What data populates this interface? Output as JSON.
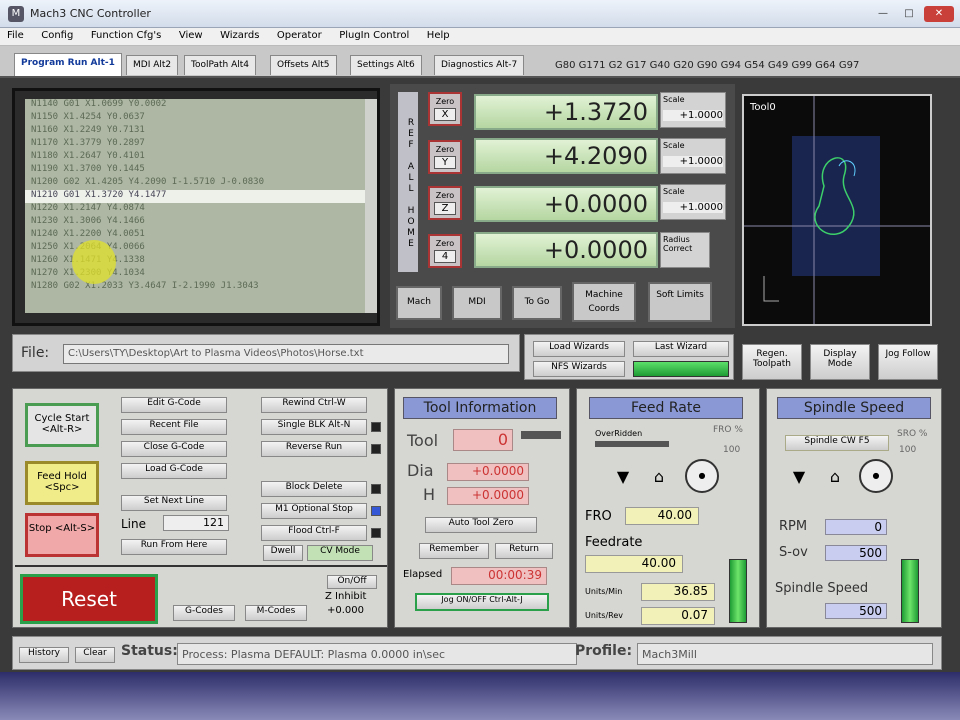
{
  "window": {
    "title": "Mach3 CNC Controller"
  },
  "menu": [
    "File",
    "Config",
    "Function Cfg's",
    "View",
    "Wizards",
    "Operator",
    "PlugIn Control",
    "Help"
  ],
  "tabs": [
    {
      "label": "Program Run Alt-1",
      "active": true
    },
    {
      "label": "MDI Alt2"
    },
    {
      "label": "ToolPath Alt4"
    },
    {
      "label": "Offsets Alt5"
    },
    {
      "label": "Settings Alt6"
    },
    {
      "label": "Diagnostics Alt-7"
    }
  ],
  "modal_codes": "G80 G171 G2 G17 G40 G20 G90 G94 G54 G49 G99 G64 G97",
  "gcode_lines": [
    "N1140 G01 X1.0699 Y0.0002",
    "N1150 X1.4254 Y0.0637",
    "N1160 X1.2249 Y0.7131",
    "N1170 X1.3779 Y0.2897",
    "N1180 X1.2647 Y0.4101",
    "N1190 X1.3700 Y0.1445",
    "N1200 G02 X1.4205 Y4.2090 I-1.5710 J-0.0830",
    "N1210 G01 X1.3720 Y4.1477",
    "N1220 X1.2147 Y4.0874",
    "N1230 X1.3006 Y4.1466",
    "N1240 X1.2200 Y4.0051",
    "N1250 X1.2064 Y4.0066",
    "N1260 X1.1471 Y4.1338",
    "N1270 X1.2300 Y4.1034",
    "N1280 G02 X1.2033 Y3.4647 I-2.1990 J1.3043"
  ],
  "dro": {
    "axes_letters": "REF ALL HOME",
    "rows": [
      {
        "ref": "Zero",
        "axis": "X",
        "value": "+1.3720",
        "scale_label": "Scale",
        "scale": "+1.0000"
      },
      {
        "ref": "Zero",
        "axis": "Y",
        "value": "+4.2090",
        "scale_label": "Scale",
        "scale": "+1.0000"
      },
      {
        "ref": "Zero",
        "axis": "Z",
        "value": "+0.0000",
        "scale_label": "Scale",
        "scale": "+1.0000"
      },
      {
        "ref": "Zero",
        "axis": "4",
        "value": "+0.0000",
        "scale_label": "Radius Correct",
        "scale": ""
      }
    ],
    "buttons": [
      "Mach",
      "MDI",
      "To Go",
      "Machine Coords",
      "Soft Limits"
    ]
  },
  "toolpath": {
    "label": "Tool0"
  },
  "file": {
    "label": "File:",
    "path": "C:\\Users\\TY\\Desktop\\Art to Plasma Videos\\Photos\\Horse.txt"
  },
  "wizards": {
    "load": "Load Wizards",
    "last": "Last Wizard",
    "nfs": "NFS Wizards"
  },
  "view_buttons": [
    "Regen. Toolpath",
    "Display Mode",
    "Jog Follow"
  ],
  "controls": {
    "cycle_start": "Cycle Start <Alt-R>",
    "feed_hold": "Feed Hold <Spc>",
    "stop": "Stop <Alt-S>",
    "edit": "Edit G-Code",
    "recent": "Recent File",
    "close": "Close G-Code",
    "load": "Load G-Code",
    "set_next": "Set Next Line",
    "line_label": "Line",
    "line_value": "121",
    "run_from": "Run From Here",
    "rewind": "Rewind Ctrl-W",
    "single": "Single BLK Alt-N",
    "reverse": "Reverse Run",
    "block_delete": "Block Delete",
    "m1": "M1 Optional Stop",
    "flood": "Flood Ctrl-F",
    "dwell": "Dwell",
    "cv": "CV Mode",
    "reset": "Reset",
    "gcodes": "G-Codes",
    "mcodes": "M-Codes",
    "on_off": "On/Off",
    "z_inhibit": "Z Inhibit",
    "z_inhibit_value": "+0.000"
  },
  "tool_info": {
    "title": "Tool Information",
    "tool_label": "Tool",
    "tool": "0",
    "dia_label": "Dia",
    "dia": "+0.0000",
    "h_label": "H",
    "h": "+0.0000",
    "auto": "Auto Tool Zero",
    "remember": "Remember",
    "return": "Return",
    "elapsed_label": "Elapsed",
    "elapsed": "00:00:39",
    "jog": "Jog ON/OFF Ctrl-Alt-J"
  },
  "feed_rate": {
    "title": "Feed Rate",
    "overridden": "OverRidden",
    "fro_pct_label": "FRO %",
    "fro_pct": "100",
    "fro_label": "FRO",
    "fro": "40.00",
    "feedrate_label": "Feedrate",
    "feedrate": "40.00",
    "units_min_label": "Units/Min",
    "units_min": "36.85",
    "units_rev_label": "Units/Rev",
    "units_rev": "0.07"
  },
  "spindle": {
    "title": "Spindle Speed",
    "cw": "Spindle CW F5",
    "sro_label": "SRO %",
    "sro": "100",
    "rpm_label": "RPM",
    "rpm": "0",
    "sov_label": "S-ov",
    "sov": "500",
    "speed_label": "Spindle Speed",
    "speed": "500"
  },
  "status": {
    "history": "History",
    "clear": "Clear",
    "label": "Status:",
    "text": "Process: Plasma  DEFAULT: Plasma  0.0000 in\\sec",
    "profile_label": "Profile:",
    "profile": "Mach3Mill"
  },
  "colors": {
    "accent": "#8a99d6",
    "dro_green": "#b5d6a1",
    "reset_red": "#b71e1e"
  }
}
